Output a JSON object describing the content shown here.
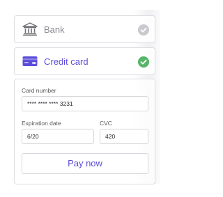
{
  "payment_methods": [
    {
      "label": "Bank",
      "selected": false,
      "icon": "bank-icon"
    },
    {
      "label": "Credit card",
      "selected": true,
      "icon": "credit-card-icon"
    }
  ],
  "form": {
    "card_number": {
      "label": "Card number",
      "value": "**** **** **** 3231"
    },
    "expiration": {
      "label": "Expiration date",
      "value": "6/20"
    },
    "cvc": {
      "label": "CVC",
      "value": "420"
    },
    "pay_button": "Pay now"
  },
  "colors": {
    "accent": "#5b4cd9",
    "selected_check": "#57b56a",
    "unselected_check": "#c9cacd",
    "border": "#dcdde2"
  }
}
